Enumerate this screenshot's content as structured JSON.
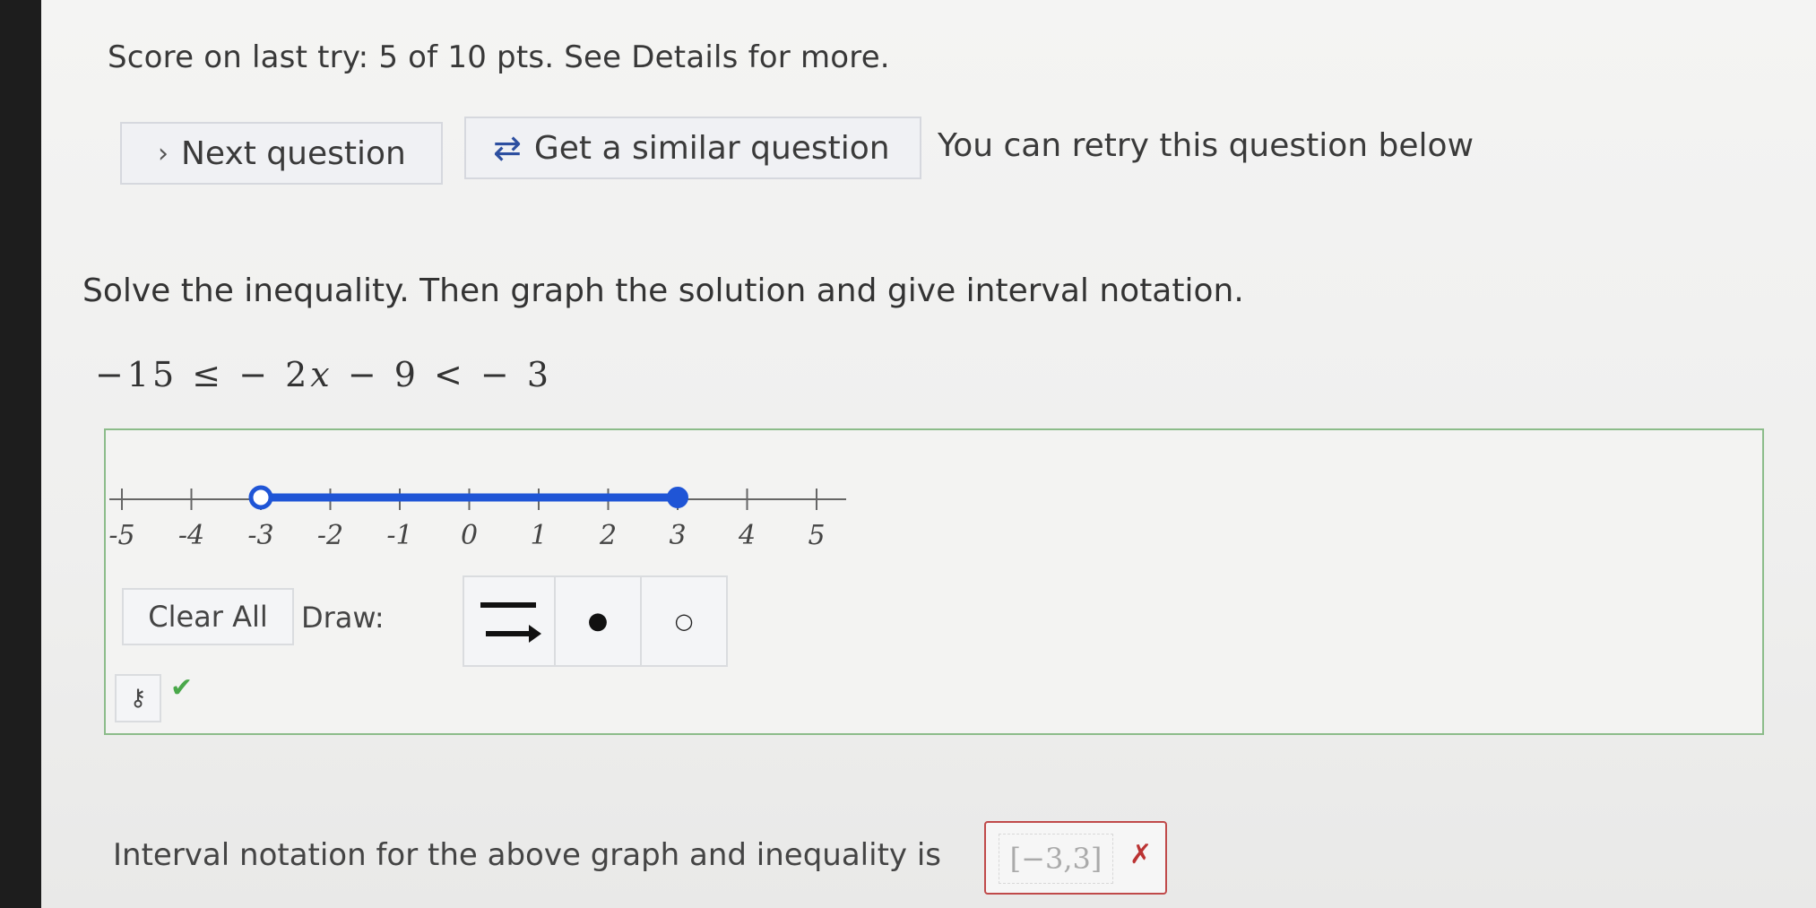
{
  "score_text": "Score on last try: 5 of 10 pts. See Details for more.",
  "buttons": {
    "next_icon": "›",
    "next_label": "Next question",
    "similar_icon": "⇄",
    "similar_label": "Get a similar question"
  },
  "retry_text": "You can retry this question below",
  "prompt": "Solve the inequality. Then graph the solution and give interval notation.",
  "inequality": {
    "left": "−15 ≤ − 2",
    "var": "x",
    "right": " − 9 < − 3"
  },
  "number_line": {
    "ticks": [
      "-5",
      "-4",
      "-3",
      "-2",
      "-1",
      "0",
      "1",
      "2",
      "3",
      "4",
      "5"
    ],
    "segment_from": -3,
    "segment_to": 3,
    "from_endpoint": "open",
    "to_endpoint": "closed",
    "segment_color": "#1f55d6"
  },
  "tools": {
    "clear_all": "Clear All",
    "draw_label": "Draw:",
    "line_tool_icon": "line-segment-arrow-icon",
    "closed_dot": "●",
    "open_dot": "○",
    "key_icon": "⚷",
    "check_mark": "✔"
  },
  "interval": {
    "label": "Interval notation for the above graph and inequality is",
    "answer": "[−3,3]",
    "incorrect_mark": "✗"
  }
}
